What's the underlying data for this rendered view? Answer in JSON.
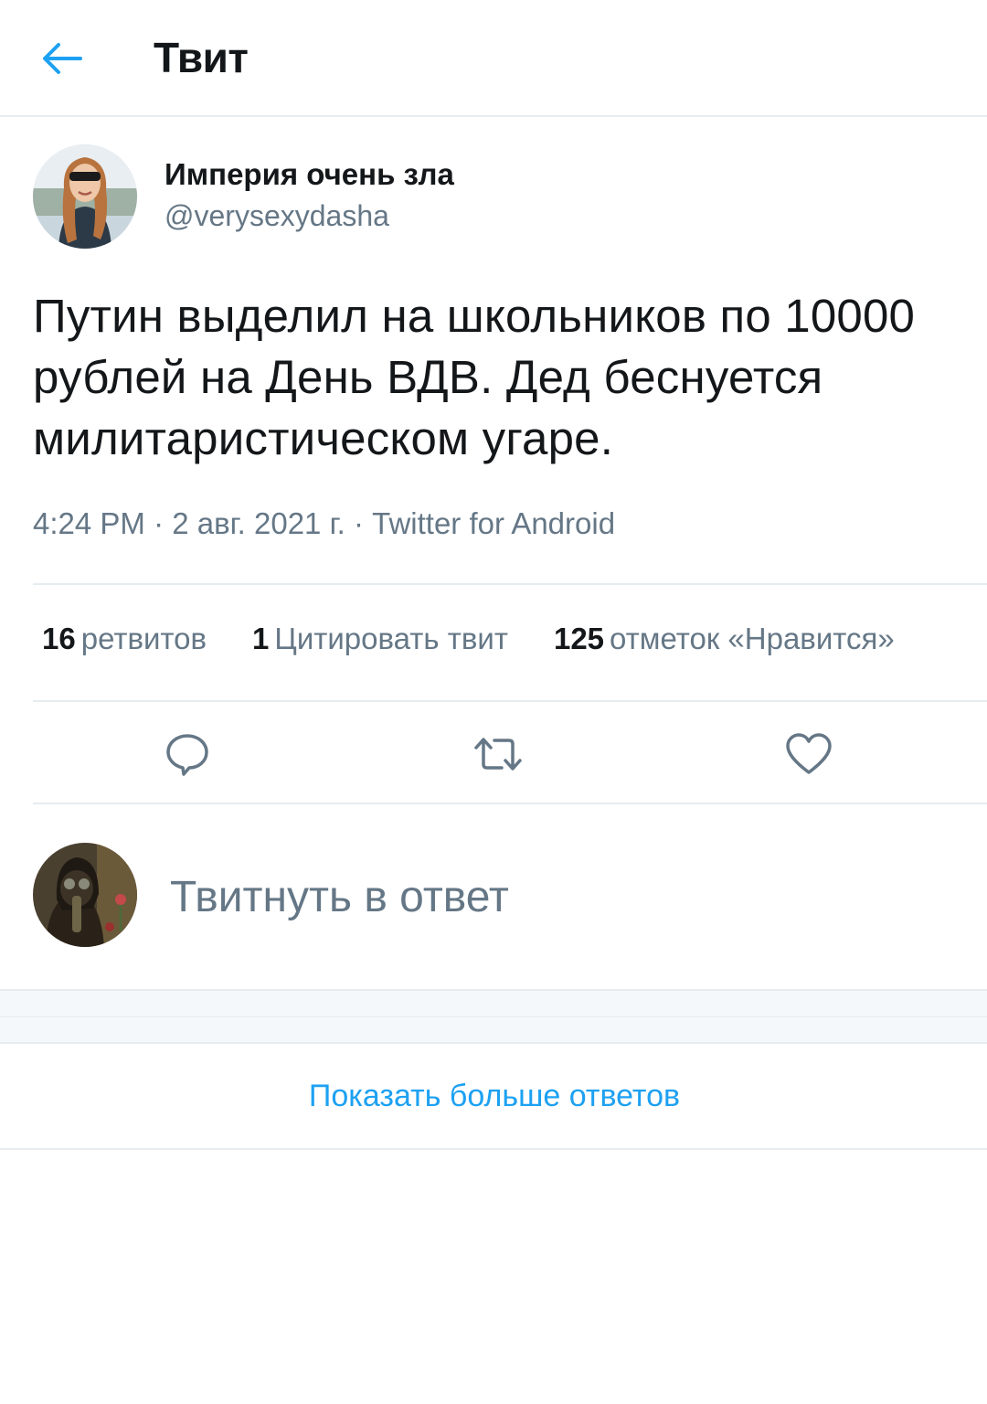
{
  "header": {
    "title": "Твит",
    "back_icon": "arrow-left-icon"
  },
  "colors": {
    "accent": "#1da1f2",
    "secondary_text": "#657786",
    "divider": "#e6ecf0"
  },
  "tweet": {
    "author": {
      "name": "Империя очень зла",
      "handle": "@verysexydasha"
    },
    "text": "Путин выделил на школьников по 10000 рублей на День ВДВ. Дед беснуется милитаристическом угаре.",
    "time": "4:24 PM",
    "date": "2 авг. 2021 г.",
    "source": "Twitter for Android",
    "separator": "·",
    "stats": {
      "retweets_count": "16",
      "retweets_label": "ретвитов",
      "quotes_count": "1",
      "quotes_label": "Цитировать твит",
      "likes_count": "125",
      "likes_label": "отметок «Нравится»"
    },
    "actions": [
      "reply-icon",
      "retweet-icon",
      "heart-icon"
    ]
  },
  "reply": {
    "placeholder": "Твитнуть в ответ"
  },
  "more": {
    "label": "Показать больше ответов"
  }
}
